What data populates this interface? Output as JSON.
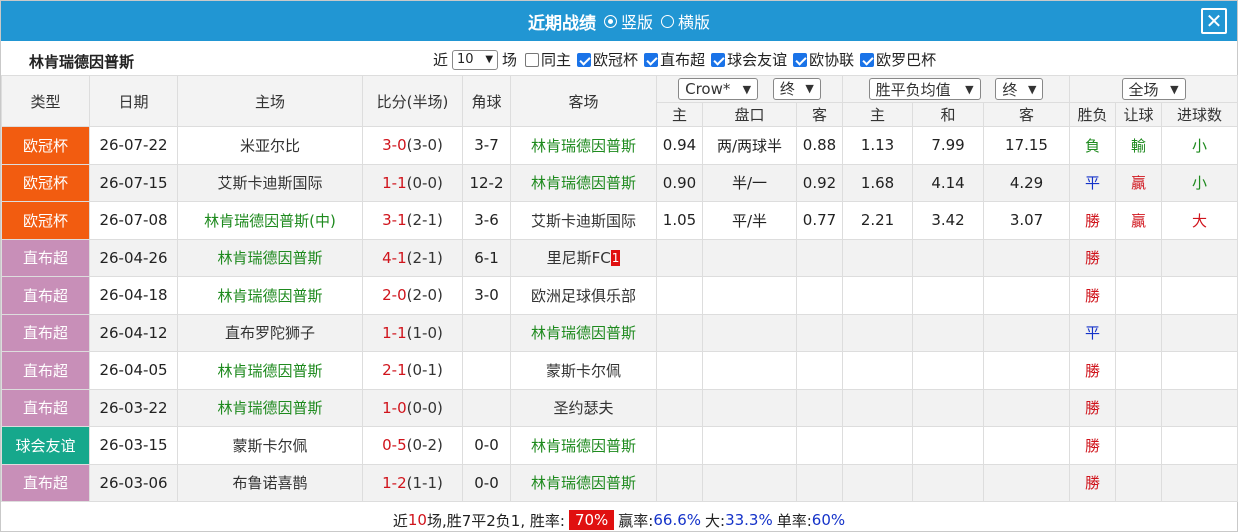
{
  "window": {
    "title": "近期战绩",
    "view_vertical": "竖版",
    "view_horizontal": "横版",
    "close": "✕"
  },
  "filters": {
    "team": "林肯瑞德因普斯",
    "recent_prefix": "近",
    "recent_count": "10",
    "recent_suffix": "场",
    "same_home": "同主",
    "leagues": [
      "欧冠杯",
      "直布超",
      "球会友谊",
      "欧协联",
      "欧罗巴杯"
    ]
  },
  "header": {
    "type": "类型",
    "date": "日期",
    "home": "主场",
    "score": "比分(半场)",
    "corner": "角球",
    "away": "客场",
    "handicap_company": "Crow*",
    "handicap_stage": "终",
    "odds_type": "胜平负均值",
    "odds_stage": "终",
    "scope": "全场",
    "h_home": "主",
    "h_line": "盘口",
    "h_away": "客",
    "o_home": "主",
    "o_draw": "和",
    "o_away": "客",
    "result": "胜负",
    "handicap_result": "让球",
    "goals": "进球数"
  },
  "colors": {
    "ucl": "#f25c10",
    "denmark": "#c88fb8",
    "friendly": "#16a88c",
    "team_green": "#1e8a1e",
    "score_red": "#d0141c",
    "draw_blue": "#1533c9"
  },
  "rows": [
    {
      "league": "欧冠杯",
      "league_color": "#f25c10",
      "date": "26-07-22",
      "home": "米亚尔比",
      "home_color": "dark",
      "score_h": "3",
      "score_a": "0",
      "half": "(3-0)",
      "corner": "3-7",
      "away": "林肯瑞德因普斯",
      "away_color": "green",
      "away_badge": "",
      "hh": "0.94",
      "hl": "两/两球半",
      "ha": "0.88",
      "oh": "1.13",
      "od": "7.99",
      "oa": "17.15",
      "res": "負",
      "res_color": "green",
      "hres": "輸",
      "hres_color": "green",
      "goals": "小",
      "goals_color": "green"
    },
    {
      "league": "欧冠杯",
      "league_color": "#f25c10",
      "date": "26-07-15",
      "home": "艾斯卡迪斯国际",
      "home_color": "dark",
      "score_h": "1",
      "score_a": "1",
      "half": "(0-0)",
      "corner": "12-2",
      "away": "林肯瑞德因普斯",
      "away_color": "green",
      "away_badge": "",
      "hh": "0.90",
      "hl": "半/一",
      "ha": "0.92",
      "oh": "1.68",
      "od": "4.14",
      "oa": "4.29",
      "res": "平",
      "res_color": "blue",
      "hres": "贏",
      "hres_color": "red",
      "goals": "小",
      "goals_color": "green"
    },
    {
      "league": "欧冠杯",
      "league_color": "#f25c10",
      "date": "26-07-08",
      "home": "林肯瑞德因普斯(中)",
      "home_color": "green",
      "score_h": "3",
      "score_a": "1",
      "half": "(2-1)",
      "corner": "3-6",
      "away": "艾斯卡迪斯国际",
      "away_color": "dark",
      "away_badge": "",
      "hh": "1.05",
      "hl": "平/半",
      "ha": "0.77",
      "oh": "2.21",
      "od": "3.42",
      "oa": "3.07",
      "res": "勝",
      "res_color": "red",
      "hres": "贏",
      "hres_color": "red",
      "goals": "大",
      "goals_color": "red"
    },
    {
      "league": "直布超",
      "league_color": "#c88fb8",
      "date": "26-04-26",
      "home": "林肯瑞德因普斯",
      "home_color": "green",
      "score_h": "4",
      "score_a": "1",
      "half": "(2-1)",
      "corner": "6-1",
      "away": "里尼斯FC",
      "away_color": "dark",
      "away_badge": "1",
      "hh": "",
      "hl": "",
      "ha": "",
      "oh": "",
      "od": "",
      "oa": "",
      "res": "勝",
      "res_color": "red",
      "hres": "",
      "hres_color": "red",
      "goals": "",
      "goals_color": "red"
    },
    {
      "league": "直布超",
      "league_color": "#c88fb8",
      "date": "26-04-18",
      "home": "林肯瑞德因普斯",
      "home_color": "green",
      "score_h": "2",
      "score_a": "0",
      "half": "(2-0)",
      "corner": "3-0",
      "away": "欧洲足球俱乐部",
      "away_color": "dark",
      "away_badge": "",
      "hh": "",
      "hl": "",
      "ha": "",
      "oh": "",
      "od": "",
      "oa": "",
      "res": "勝",
      "res_color": "red",
      "hres": "",
      "hres_color": "red",
      "goals": "",
      "goals_color": "red"
    },
    {
      "league": "直布超",
      "league_color": "#c88fb8",
      "date": "26-04-12",
      "home": "直布罗陀狮子",
      "home_color": "dark",
      "score_h": "1",
      "score_a": "1",
      "half": "(1-0)",
      "corner": "",
      "away": "林肯瑞德因普斯",
      "away_color": "green",
      "away_badge": "",
      "hh": "",
      "hl": "",
      "ha": "",
      "oh": "",
      "od": "",
      "oa": "",
      "res": "平",
      "res_color": "blue",
      "hres": "",
      "hres_color": "red",
      "goals": "",
      "goals_color": "red"
    },
    {
      "league": "直布超",
      "league_color": "#c88fb8",
      "date": "26-04-05",
      "home": "林肯瑞德因普斯",
      "home_color": "green",
      "score_h": "2",
      "score_a": "1",
      "half": "(0-1)",
      "corner": "",
      "away": "蒙斯卡尔佩",
      "away_color": "dark",
      "away_badge": "",
      "hh": "",
      "hl": "",
      "ha": "",
      "oh": "",
      "od": "",
      "oa": "",
      "res": "勝",
      "res_color": "red",
      "hres": "",
      "hres_color": "red",
      "goals": "",
      "goals_color": "red"
    },
    {
      "league": "直布超",
      "league_color": "#c88fb8",
      "date": "26-03-22",
      "home": "林肯瑞德因普斯",
      "home_color": "green",
      "score_h": "1",
      "score_a": "0",
      "half": "(0-0)",
      "corner": "",
      "away": "圣约瑟夫",
      "away_color": "dark",
      "away_badge": "",
      "hh": "",
      "hl": "",
      "ha": "",
      "oh": "",
      "od": "",
      "oa": "",
      "res": "勝",
      "res_color": "red",
      "hres": "",
      "hres_color": "red",
      "goals": "",
      "goals_color": "red"
    },
    {
      "league": "球会友谊",
      "league_color": "#16a88c",
      "date": "26-03-15",
      "home": "蒙斯卡尔佩",
      "home_color": "dark",
      "score_h": "0",
      "score_a": "5",
      "half": "(0-2)",
      "corner": "0-0",
      "away": "林肯瑞德因普斯",
      "away_color": "green",
      "away_badge": "",
      "hh": "",
      "hl": "",
      "ha": "",
      "oh": "",
      "od": "",
      "oa": "",
      "res": "勝",
      "res_color": "red",
      "hres": "",
      "hres_color": "red",
      "goals": "",
      "goals_color": "red"
    },
    {
      "league": "直布超",
      "league_color": "#c88fb8",
      "date": "26-03-06",
      "home": "布鲁诺喜鹊",
      "home_color": "dark",
      "score_h": "1",
      "score_a": "2",
      "half": "(1-1)",
      "corner": "0-0",
      "away": "林肯瑞德因普斯",
      "away_color": "green",
      "away_badge": "",
      "hh": "",
      "hl": "",
      "ha": "",
      "oh": "",
      "od": "",
      "oa": "",
      "res": "勝",
      "res_color": "red",
      "hres": "",
      "hres_color": "red",
      "goals": "",
      "goals_color": "red"
    }
  ],
  "summary": {
    "prefix": "近",
    "count": "10",
    "record": "场,胜7平2负1, 胜率:",
    "win_rate": "70%",
    "win_label": "赢率:",
    "win_value": "66.6%",
    "big_label": "大:",
    "big_value": "33.3%",
    "odd_label": "单率:",
    "odd_value": "60%"
  }
}
